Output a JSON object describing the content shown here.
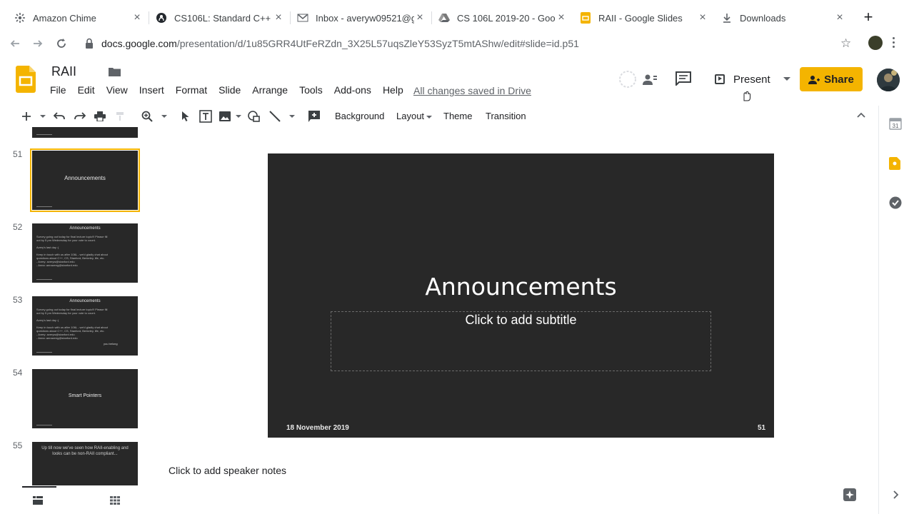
{
  "browser": {
    "tabs": [
      {
        "label": "Amazon Chime",
        "icon": "amazon-chime-icon"
      },
      {
        "label": "CS106L: Standard C++",
        "icon": "github-icon"
      },
      {
        "label": "Inbox - averyw09521@g",
        "icon": "gmail-icon"
      },
      {
        "label": "CS 106L 2019-20 - Goo",
        "icon": "google-drive-icon"
      },
      {
        "label": "RAII - Google Slides",
        "icon": "google-slides-icon"
      },
      {
        "label": "Downloads",
        "icon": "download-icon"
      }
    ],
    "active_tab": 4,
    "url_host": "docs.google.com",
    "url_path": "/presentation/d/1u85GRR4UtFeRZdn_3X25L57uqsZleY53SyzT5mtAShw/edit#slide=id.p51"
  },
  "app": {
    "doc_title": "RAII",
    "menu": [
      "File",
      "Edit",
      "View",
      "Insert",
      "Format",
      "Slide",
      "Arrange",
      "Tools",
      "Add-ons",
      "Help"
    ],
    "save_status": "All changes saved in Drive",
    "present_label": "Present",
    "share_label": "Share",
    "brand_color": "#f4b400"
  },
  "toolbar": {
    "background_label": "Background",
    "layout_label": "Layout",
    "theme_label": "Theme",
    "transition_label": "Transition"
  },
  "filmstrip": {
    "slides": [
      {
        "number": "51",
        "title": "Announcements",
        "selected": true
      },
      {
        "number": "52",
        "title": "Announcements",
        "body": [
          "Survey going out today for final lecture topic!!! Please fill",
          "out by 5 pm Wednesday for your vote to count.",
          "",
          "Avery's last day :(",
          "",
          "Keep in touch with us after 106L - we'd gladly chat about",
          "questions about C++, CS, Stanford, Berkeley, life, etc.",
          "  - Avery: averyw@stanford.edu",
          "  - Anna: annazeng@stanford.edu"
        ]
      },
      {
        "number": "53",
        "title": "Announcements",
        "body": [
          "Survey going out today for final lecture topic!!! Please fill",
          "out by 5 pm Wednesday for your vote to count.",
          "",
          "Avery's last day :(",
          "",
          "Keep in touch with us after 106L - we'd gladly chat about",
          "questions about C++, CS, Stanford, Berkeley, life, etc.",
          "  - Avery: averyw@stanford.edu",
          "  - Anna: annazeng@stanford.edu"
        ],
        "signature": "you belong"
      },
      {
        "number": "54",
        "title": "Smart Pointers"
      },
      {
        "number": "55",
        "title": "Up till now we've seen how RAII-enabling and looks can be non-RAII compliant..."
      }
    ]
  },
  "slide": {
    "title": "Announcements",
    "subtitle_placeholder": "Click to add subtitle",
    "date": "18 November 2019",
    "page_number": "51"
  },
  "speaker_notes_placeholder": "Click to add speaker notes"
}
